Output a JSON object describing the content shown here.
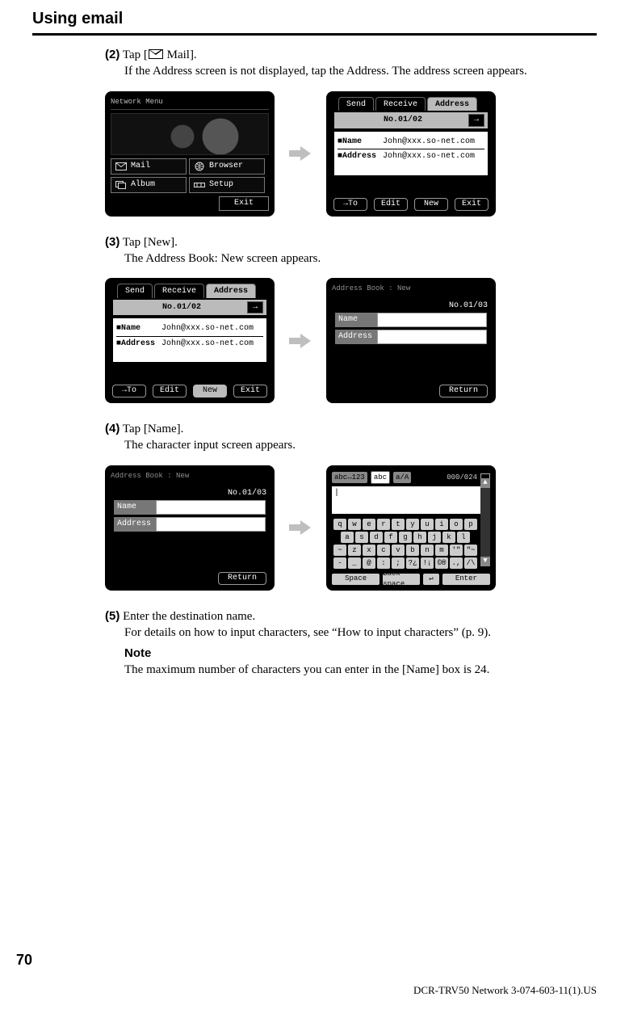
{
  "page": {
    "title": "Using email",
    "number": "70",
    "footer": "DCR-TRV50 Network 3-074-603-11(1).US"
  },
  "steps": {
    "s2": {
      "num": "(2)",
      "first_a": "Tap [",
      "first_b": " Mail].",
      "rest": "If the Address screen is not displayed, tap the Address. The address screen appears."
    },
    "s3": {
      "num": "(3)",
      "first": "Tap [New].",
      "rest": "The Address Book: New screen appears."
    },
    "s4": {
      "num": "(4)",
      "first": "Tap [Name].",
      "rest": "The character input screen appears."
    },
    "s5": {
      "num": "(5)",
      "first": "Enter the destination name.",
      "rest": "For details on how to input characters, see “How to input characters” (p. 9).",
      "note_heading": "Note",
      "note_body": "The maximum number of characters you can enter in the [Name] box is 24."
    }
  },
  "screens": {
    "network_menu": {
      "title": "Network Menu",
      "mail": "Mail",
      "browser": "Browser",
      "album": "Album",
      "setup": "Setup",
      "exit": "Exit"
    },
    "address": {
      "tab_send": "Send",
      "tab_receive": "Receive",
      "tab_address": "Address",
      "page_indicator": "No.01/02",
      "name_label": "■Name",
      "name_value": "John@xxx.so-net.com",
      "addr_label": "■Address",
      "addr_value": "John@xxx.so-net.com",
      "btn_to": "→To",
      "btn_edit": "Edit",
      "btn_new": "New",
      "btn_exit": "Exit"
    },
    "addrbook_new": {
      "title": "Address Book : New",
      "page_indicator": "No.01/03",
      "name_label": "Name",
      "addr_label": "Address",
      "return": "Return"
    },
    "keyboard": {
      "mode1": "abc↔123",
      "mode2": "abc",
      "mode3": "a/A",
      "counter": "000/024",
      "row1": [
        "q",
        "w",
        "e",
        "r",
        "t",
        "y",
        "u",
        "i",
        "o",
        "p"
      ],
      "row2": [
        "a",
        "s",
        "d",
        "f",
        "g",
        "h",
        "j",
        "k",
        "l"
      ],
      "row3": [
        "~",
        "z",
        "x",
        "c",
        "v",
        "b",
        "n",
        "m",
        "'\"",
        "\"~"
      ],
      "row4": [
        "-",
        "_",
        "@",
        ":",
        ";",
        "?¿",
        "!¡",
        "©®",
        ".,",
        "/\\"
      ],
      "space": "Space",
      "backspace": "Back space",
      "ret": "↵",
      "enter": "Enter"
    }
  }
}
